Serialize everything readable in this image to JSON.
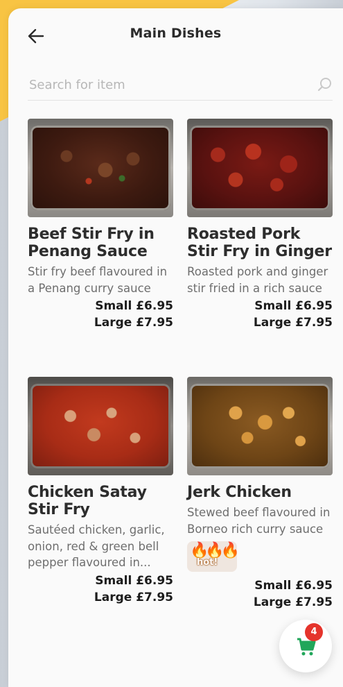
{
  "header": {
    "title": "Main Dishes",
    "back_icon": "arrow-left-icon"
  },
  "search": {
    "placeholder": "Search for item",
    "value": "",
    "icon": "search-icon"
  },
  "items": [
    {
      "name": "Beef Stir Fry in Penang Sauce",
      "description": "Stir fry beef flavoured in a Penang curry sauce",
      "price_small": "Small £6.95",
      "price_large": "Large £7.95",
      "image": "beef-stir-fry-image"
    },
    {
      "name": "Roasted Pork Stir Fry in Ginger",
      "description": "Roasted pork and ginger stir fried in a rich sauce",
      "price_small": "Small £6.95",
      "price_large": "Large £7.95",
      "image": "roasted-pork-image"
    },
    {
      "name": "Chicken Satay Stir Fry",
      "description": "Sautéed chicken, garlic, onion, red & green bell pepper flavoured in...",
      "price_small": "Small £6.95",
      "price_large": "Large £7.95",
      "image": "chicken-satay-image"
    },
    {
      "name": "Jerk Chicken",
      "description": "Stewed beef flavoured in Borneo rich curry sauce",
      "badge": "hot!",
      "price_small": "Small £6.95",
      "price_large": "Large £7.95",
      "image": "jerk-chicken-image"
    }
  ],
  "cart": {
    "count": "4",
    "icon": "shopping-cart-icon"
  },
  "colors": {
    "accent_yellow": "#f8c443",
    "cart_green": "#21a65a",
    "badge_red": "#e5342c"
  }
}
